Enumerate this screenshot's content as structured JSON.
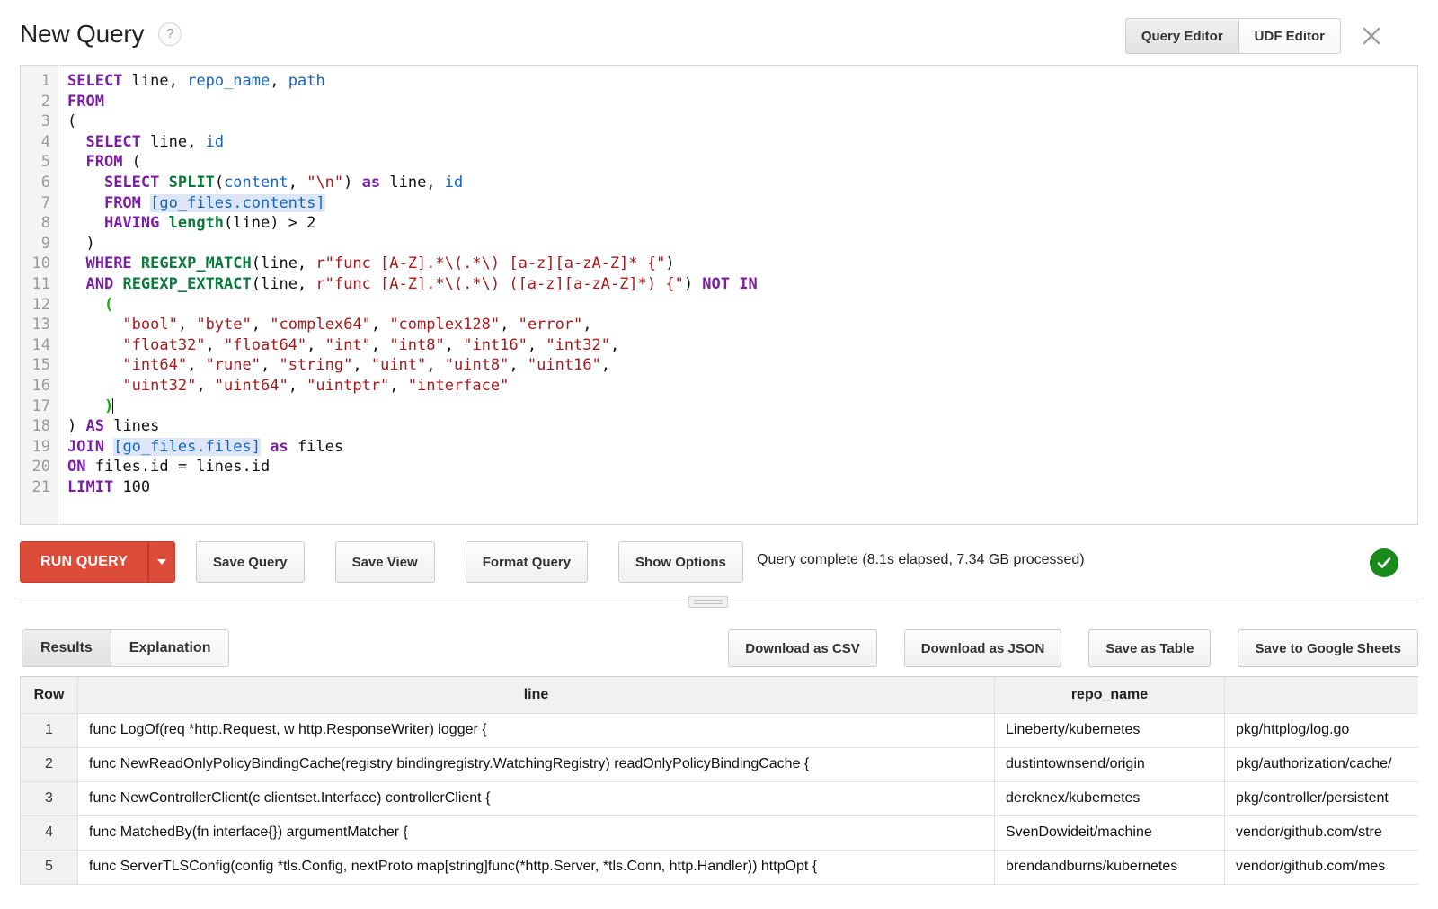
{
  "header": {
    "title": "New Query",
    "help_icon": "?",
    "tabs": [
      {
        "label": "Query Editor",
        "active": true
      },
      {
        "label": "UDF Editor",
        "active": false
      }
    ],
    "close_label": "×"
  },
  "editor": {
    "line_numbers": [
      "1",
      "2",
      "3",
      "4",
      "5",
      "6",
      "7",
      "8",
      "9",
      "10",
      "11",
      "12",
      "13",
      "14",
      "15",
      "16",
      "17",
      "18",
      "19",
      "20",
      "21"
    ],
    "query_text": "SELECT line, repo_name, path\nFROM\n(\n  SELECT line, id\n  FROM (\n    SELECT SPLIT(content, \"\\n\") as line, id\n    FROM [go_files.contents]\n    HAVING length(line) > 2\n  )\n  WHERE REGEXP_MATCH(line, r\"func [A-Z].*\\(.*\\) [a-z][a-zA-Z]* {\")\n  AND REGEXP_EXTRACT(line, r\"func [A-Z].*\\(.*\\) ([a-z][a-zA-Z]*) {\") NOT IN\n    (\n      \"bool\", \"byte\", \"complex64\", \"complex128\", \"error\",\n      \"float32\", \"float64\", \"int\", \"int8\", \"int16\", \"int32\",\n      \"int64\", \"rune\", \"string\", \"uint\", \"uint8\", \"uint16\",\n      \"uint32\", \"uint64\", \"uintptr\", \"interface\"\n    )\n) AS lines\nJOIN [go_files.files] as files\nON files.id = lines.id\nLIMIT 100",
    "highlight_colors": {
      "keyword": "#7b1fa2",
      "identifier": "#1565c0",
      "function": "#0b7a3b",
      "string": "#a61b1b",
      "table_token_bg": "#dde6f7",
      "matched_paren": "#00b300"
    }
  },
  "actionbar": {
    "run_label": "RUN QUERY",
    "buttons": [
      "Save Query",
      "Save View",
      "Format Query",
      "Show Options"
    ],
    "status_text": "Query complete (8.1s elapsed, 7.34 GB processed)",
    "status_color": "#1a8a1a",
    "run_color": "#dd4b39"
  },
  "results": {
    "tabs": [
      {
        "label": "Results",
        "active": true
      },
      {
        "label": "Explanation",
        "active": false
      }
    ],
    "download_buttons": [
      "Download as CSV",
      "Download as JSON",
      "Save as Table",
      "Save to Google Sheets"
    ],
    "columns": [
      "Row",
      "line",
      "repo_name",
      ""
    ],
    "rows": [
      {
        "row": "1",
        "line": "func LogOf(req *http.Request, w http.ResponseWriter) logger {",
        "repo_name": "Lineberty/kubernetes",
        "path": "pkg/httplog/log.go"
      },
      {
        "row": "2",
        "line": "func NewReadOnlyPolicyBindingCache(registry bindingregistry.WatchingRegistry) readOnlyPolicyBindingCache {",
        "repo_name": "dustintownsend/origin",
        "path": "pkg/authorization/cache/"
      },
      {
        "row": "3",
        "line": "func NewControllerClient(c clientset.Interface) controllerClient {",
        "repo_name": "dereknex/kubernetes",
        "path": "pkg/controller/persistent"
      },
      {
        "row": "4",
        "line": "func MatchedBy(fn interface{}) argumentMatcher {",
        "repo_name": "SvenDowideit/machine",
        "path": "vendor/github.com/stre"
      },
      {
        "row": "5",
        "line": "func ServerTLSConfig(config *tls.Config, nextProto map[string]func(*http.Server, *tls.Conn, http.Handler)) httpOpt {",
        "repo_name": "brendandburns/kubernetes",
        "path": "vendor/github.com/mes"
      }
    ]
  }
}
